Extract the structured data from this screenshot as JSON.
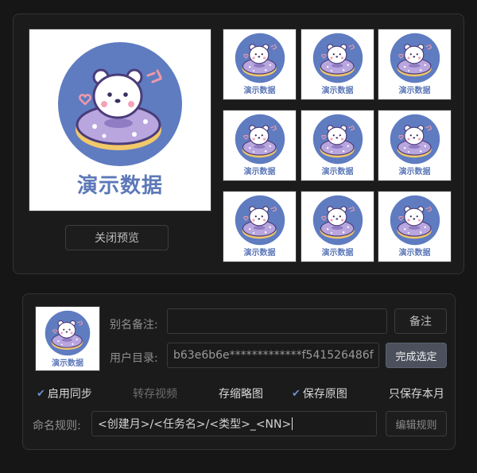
{
  "preview": {
    "caption": "演示数据",
    "close_label": "关闭预览"
  },
  "settings": {
    "thumb_caption": "演示数据",
    "alias_label": "别名备注:",
    "alias_value": "",
    "note_button": "备注",
    "user_dir_label": "用户目录:",
    "user_dir_value": "b63e6b6e*************f541526486f",
    "finish_button": "完成选定",
    "options": [
      {
        "label": "启用同步",
        "checked": true,
        "state": "on"
      },
      {
        "label": "转存视频",
        "checked": false,
        "state": "disabled"
      },
      {
        "label": "存缩略图",
        "checked": false,
        "state": "on"
      },
      {
        "label": "保存原图",
        "checked": true,
        "state": "on"
      },
      {
        "label": "只保存本月",
        "checked": false,
        "state": "on"
      }
    ],
    "naming_label": "命名规则:",
    "naming_value": "<创建月>/<任务名>/<类型>_<NN>",
    "edit_rule_button": "编辑规则"
  },
  "colors": {
    "accent": "#6d8fd0",
    "logo_circle": "#5f7cc1",
    "caption": "#5c78b8",
    "donut": "#b9a6df"
  },
  "icons": [
    "bear-donut-logo",
    "check-icon"
  ]
}
